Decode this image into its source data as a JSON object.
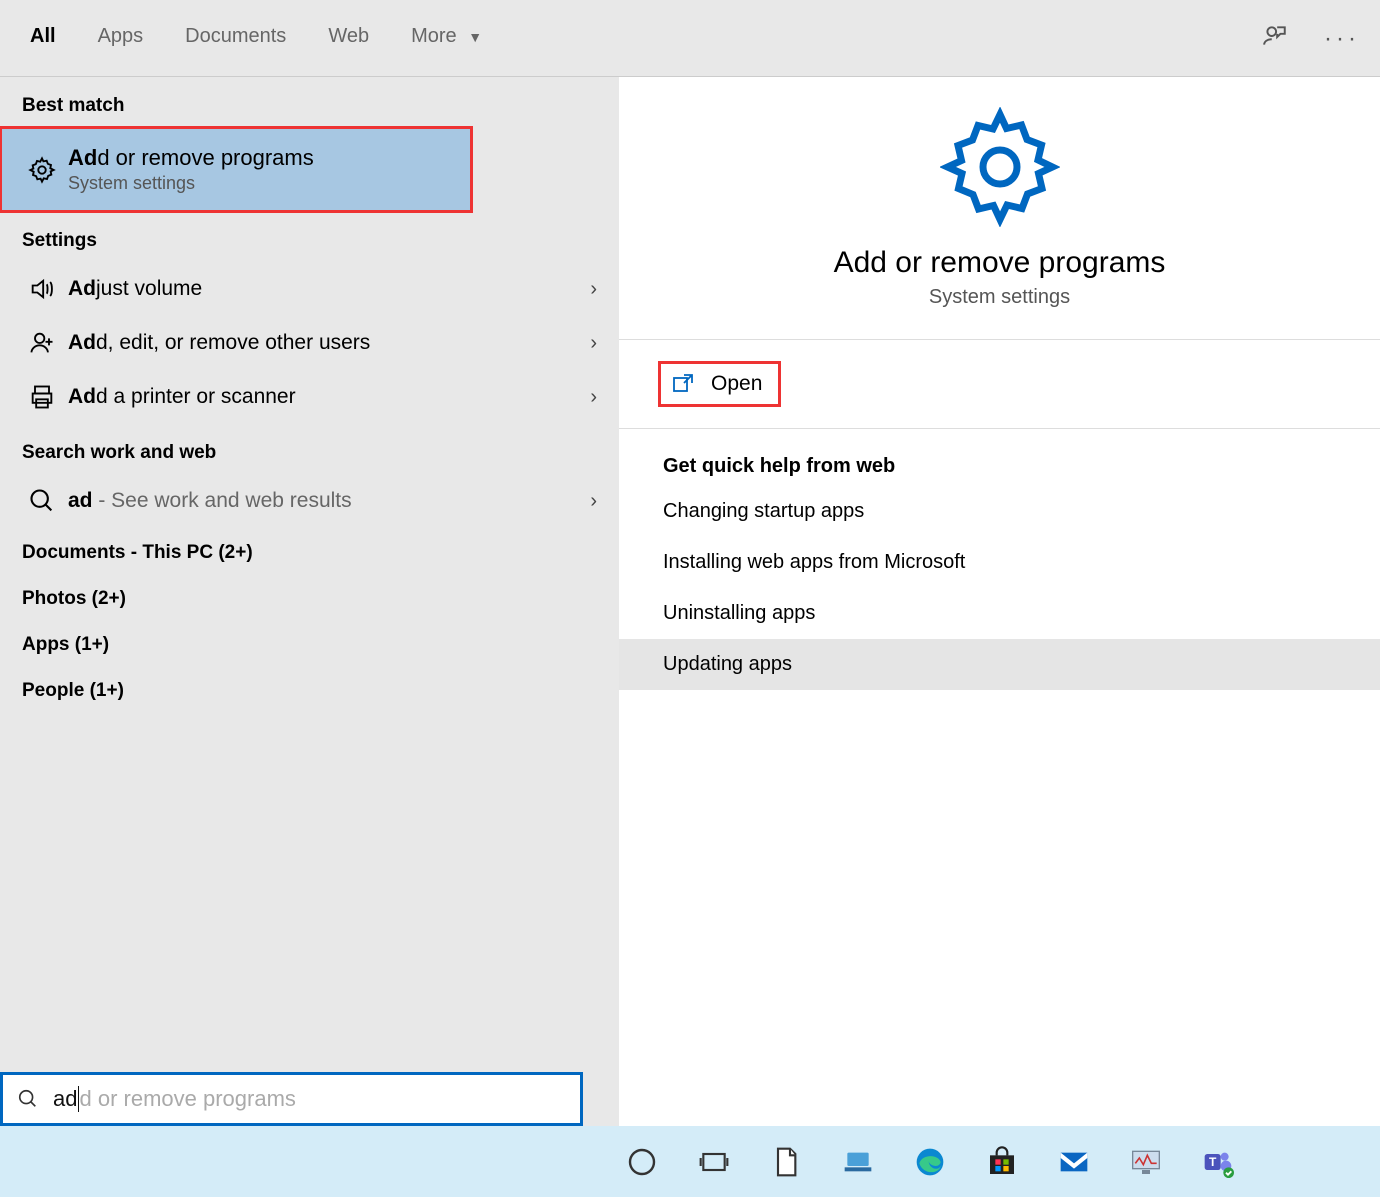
{
  "tabs": {
    "all": "All",
    "apps": "Apps",
    "documents": "Documents",
    "web": "Web",
    "more": "More"
  },
  "sections": {
    "best_match": "Best match",
    "settings": "Settings",
    "search_web": "Search work and web"
  },
  "best_match": {
    "bold": "Ad",
    "rest": "d or remove programs",
    "sub": "System settings"
  },
  "settings_items": [
    {
      "bold": "Ad",
      "rest": "just volume",
      "icon": "volume"
    },
    {
      "bold": "Ad",
      "rest": "d, edit, or remove other users",
      "icon": "person-add"
    },
    {
      "bold": "Ad",
      "rest": "d a printer or scanner",
      "icon": "printer"
    }
  ],
  "web_item": {
    "bold": "ad",
    "rest": " - See work and web results"
  },
  "groups": [
    "Documents - This PC (2+)",
    "Photos (2+)",
    "Apps (1+)",
    "People (1+)"
  ],
  "detail": {
    "title": "Add or remove programs",
    "sub": "System settings",
    "open": "Open",
    "quick_help": "Get quick help from web",
    "links": [
      "Changing startup apps",
      "Installing web apps from Microsoft",
      "Uninstalling apps",
      "Updating apps"
    ]
  },
  "search": {
    "typed": "ad",
    "ghost": "d or remove programs"
  },
  "taskbar_icons": [
    "cortana",
    "task-view",
    "document",
    "laptop",
    "edge",
    "store",
    "mail",
    "monitor",
    "teams"
  ]
}
